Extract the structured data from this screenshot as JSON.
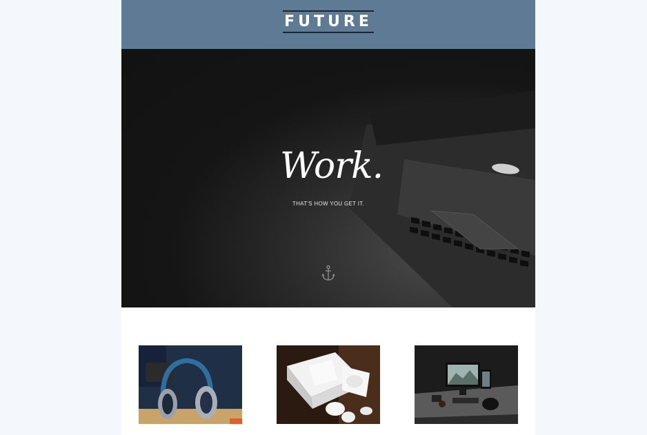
{
  "header": {
    "logo_text": "FUTURE"
  },
  "hero": {
    "title": "Work.",
    "subtitle": "THAT'S HOW YOU GET IT.",
    "scroll_icon": "anchor-icon"
  },
  "products": [
    {
      "name": "headphones",
      "icon": "headphones-image"
    },
    {
      "name": "earbuds-box",
      "icon": "earbuds-image"
    },
    {
      "name": "desk-setup",
      "icon": "desk-image"
    }
  ],
  "colors": {
    "page_bg": "#f4f8fc",
    "header_bg": "#5f7a95",
    "hero_bg": "#121212",
    "content_bg": "#ffffff"
  }
}
